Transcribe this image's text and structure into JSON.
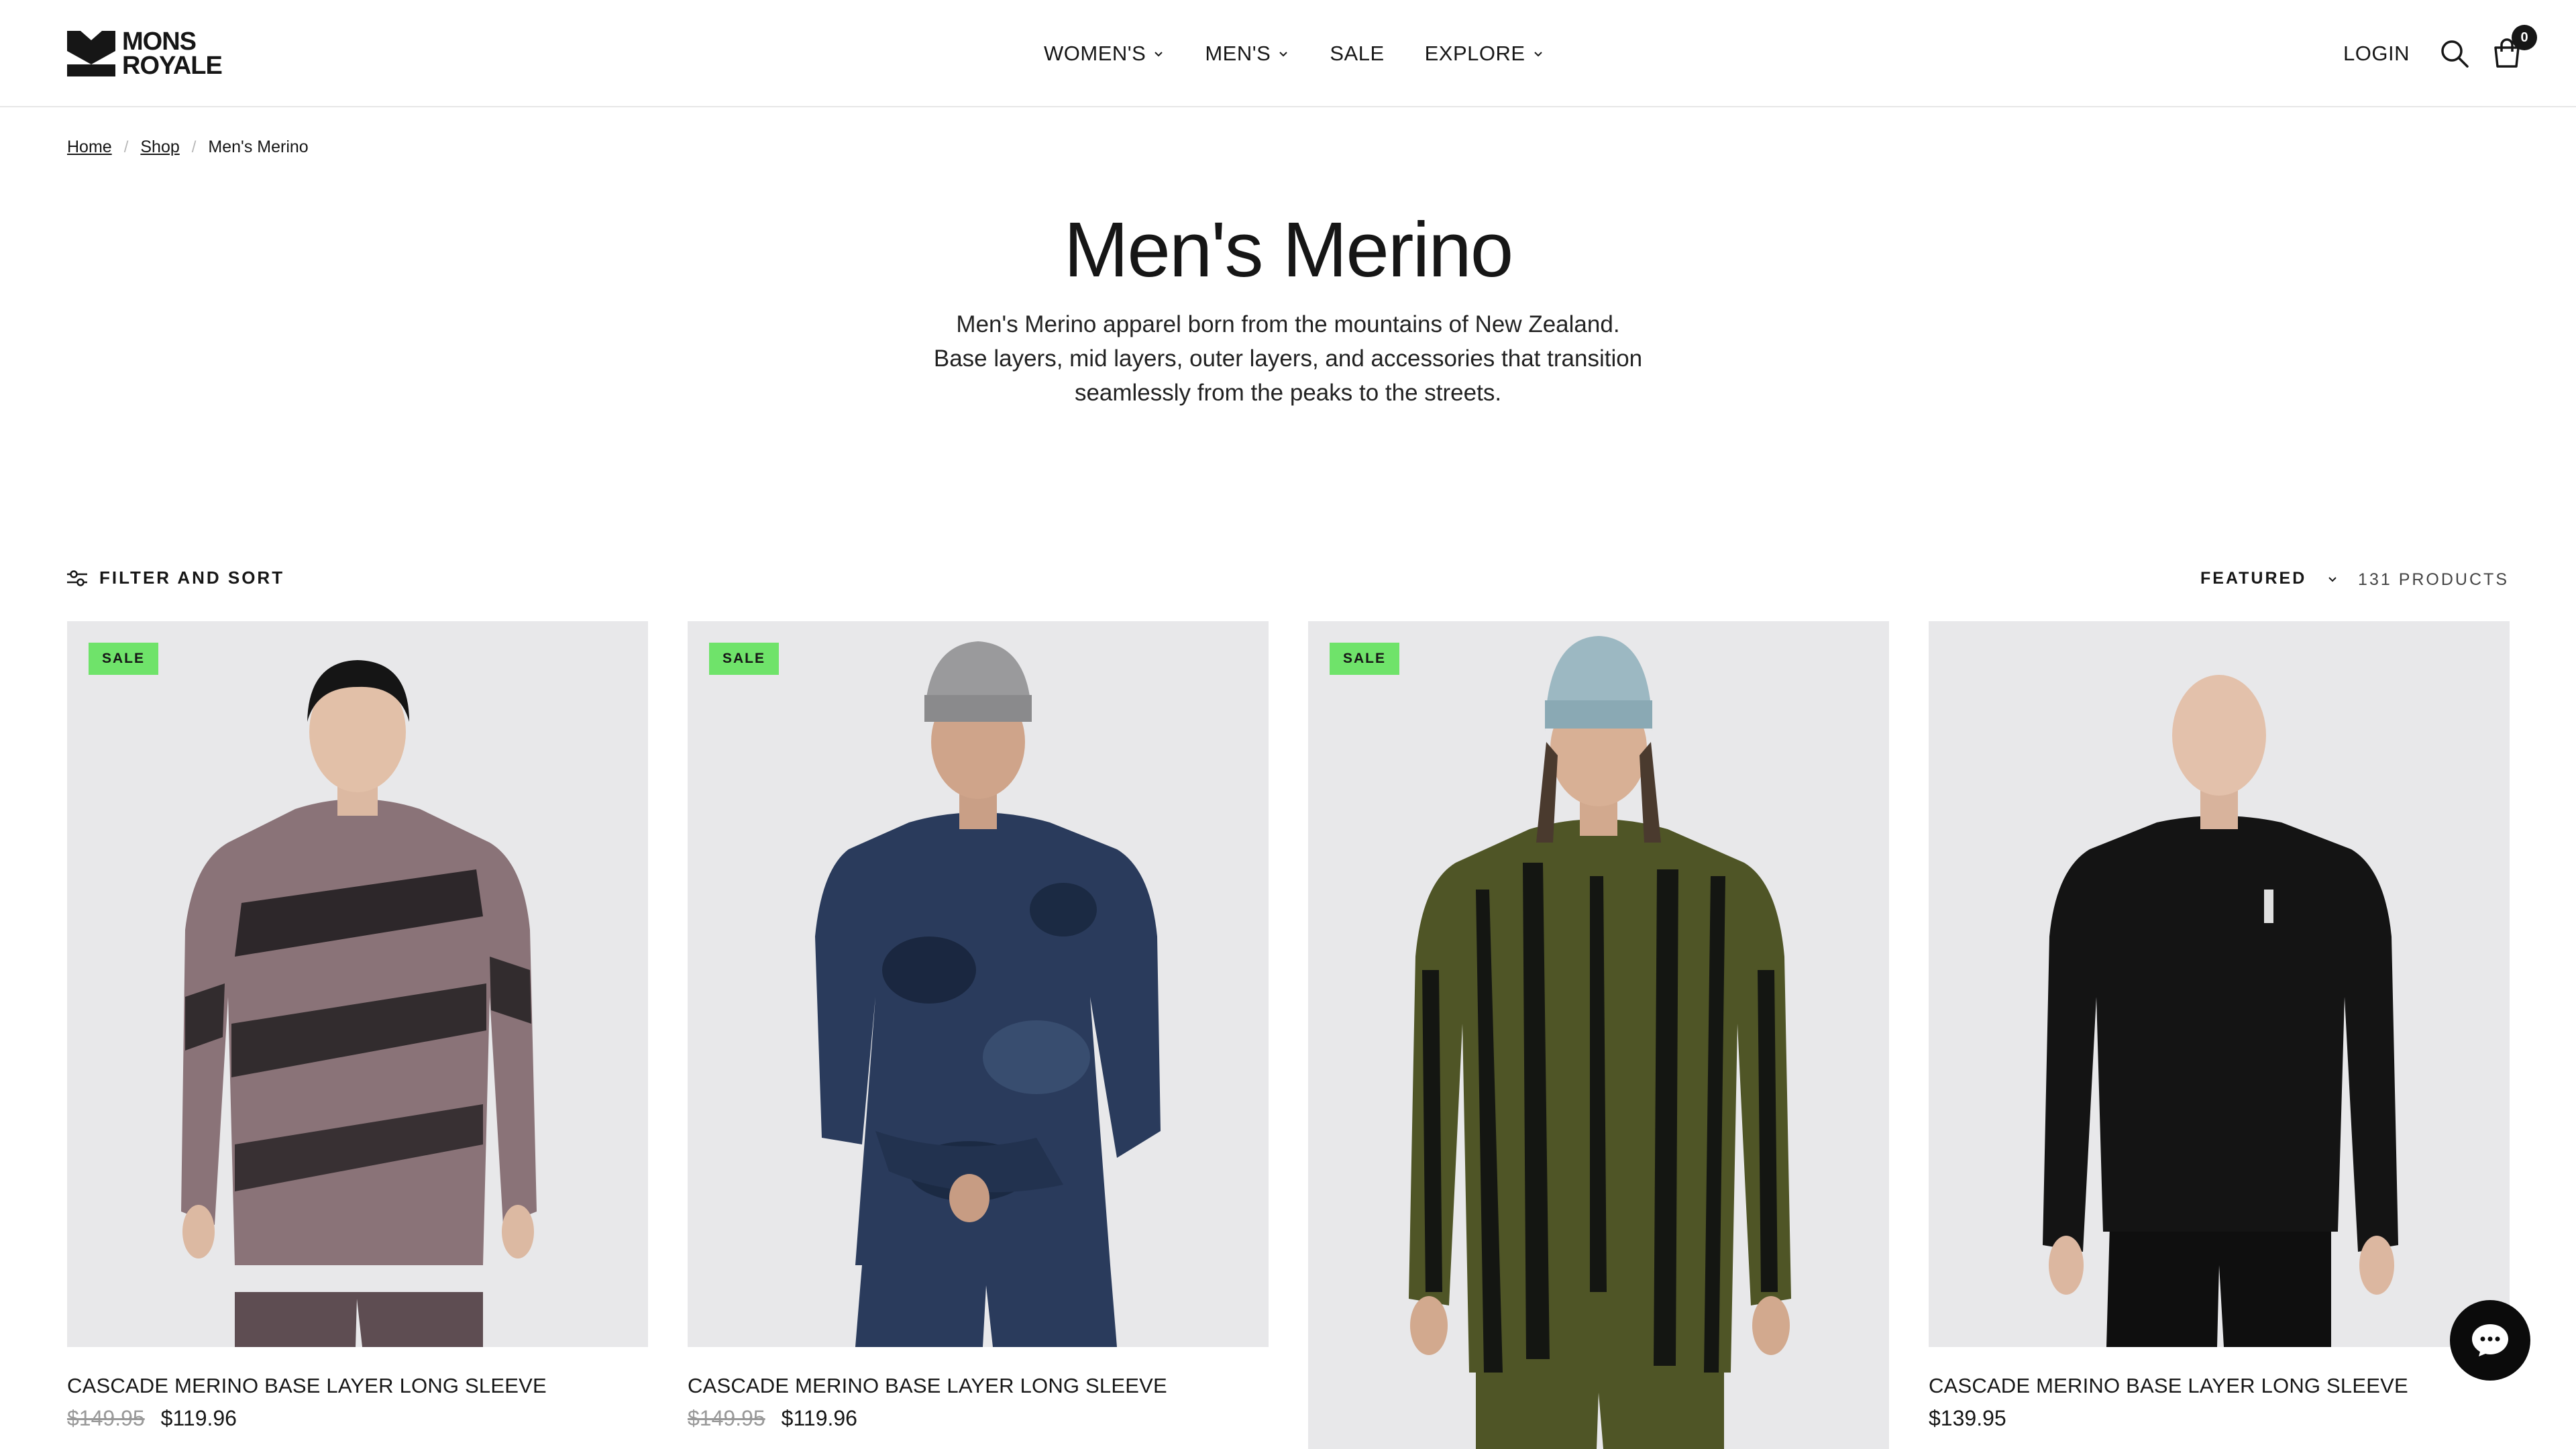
{
  "brand": {
    "line1": "MONS",
    "line2": "ROYALE"
  },
  "nav": {
    "items": [
      {
        "label": "WOMEN'S",
        "has_menu": true
      },
      {
        "label": "MEN'S",
        "has_menu": true
      },
      {
        "label": "SALE",
        "has_menu": false
      },
      {
        "label": "EXPLORE",
        "has_menu": true
      }
    ]
  },
  "header": {
    "login_label": "LOGIN",
    "cart_count": "0"
  },
  "breadcrumb": {
    "home": "Home",
    "shop": "Shop",
    "current": "Men's Merino",
    "separator": "/"
  },
  "page": {
    "title": "Men's Merino",
    "description": "Men's Merino apparel born from the mountains of New Zealand. Base layers, mid layers, outer layers, and accessories that transition seamlessly from the peaks to the streets."
  },
  "toolbar": {
    "filter_label": "FILTER AND SORT",
    "sort_label": "FEATURED",
    "product_count": "131 PRODUCTS"
  },
  "products": [
    {
      "name": "CASCADE MERINO BASE LAYER LONG SLEEVE",
      "badge": "SALE",
      "old_price": "$149.95",
      "price": "$119.96",
      "color": "#8a7378",
      "pattern": "brush"
    },
    {
      "name": "CASCADE MERINO BASE LAYER LONG SLEEVE",
      "badge": "SALE",
      "old_price": "$149.95",
      "price": "$119.96",
      "color": "#2a3b5c",
      "pattern": "cloud"
    },
    {
      "name": "",
      "badge": "SALE",
      "old_price": "",
      "price": "",
      "color": "#4f5526",
      "pattern": "tiedye"
    },
    {
      "name": "CASCADE MERINO BASE LAYER LONG SLEEVE",
      "badge": "",
      "old_price": "",
      "price": "$139.95",
      "color": "#111111",
      "pattern": "solid"
    }
  ],
  "colors": {
    "sale_badge": "#6fe36a",
    "text": "#161616",
    "image_bg": "#e8e8ea"
  }
}
